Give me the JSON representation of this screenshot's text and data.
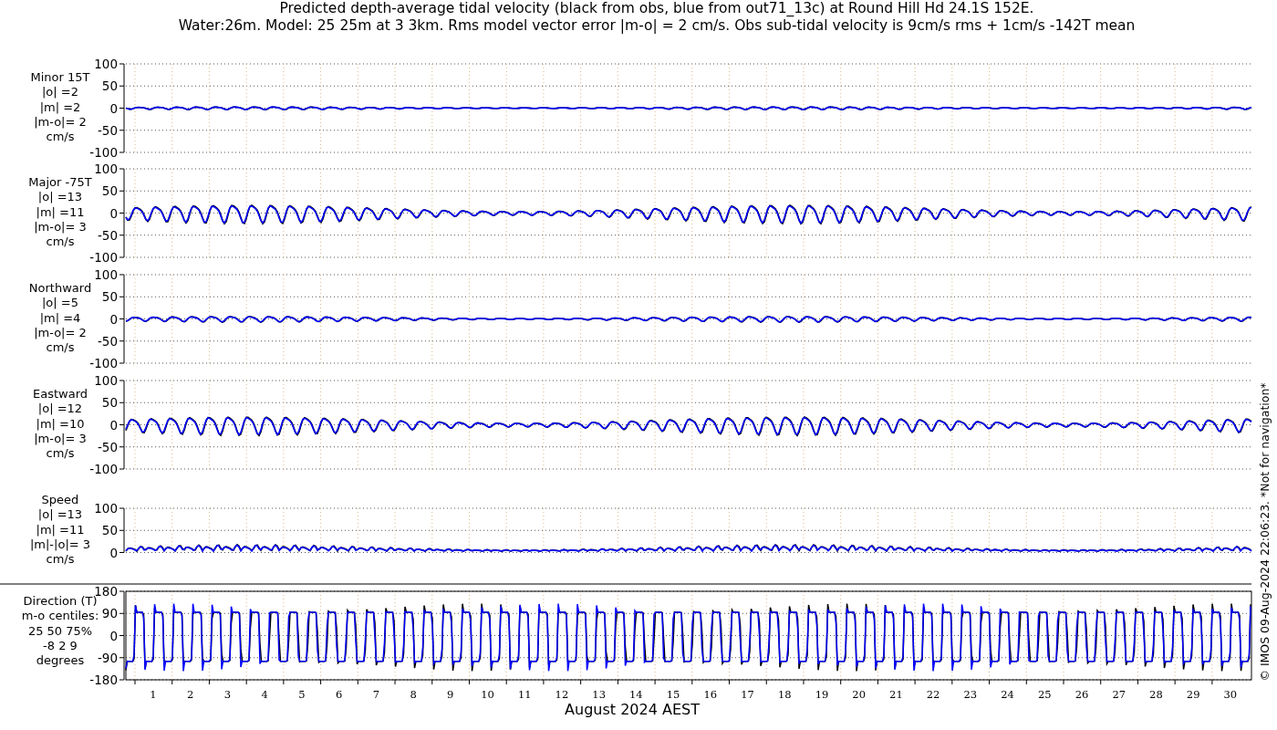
{
  "title_lines": [
    "Predicted depth-average tidal velocity (black from obs, blue from out71_13c) at Round Hill Hd 24.1S 152E.",
    "Water:26m. Model: 25 25m at 3 3km. Rms model vector error |m-o| = 2 cm/s. Obs sub-tidal velocity is 9cm/s rms + 1cm/s -142T mean"
  ],
  "panels": [
    {
      "kind": "velocity",
      "label_lines": [
        "Minor 15T",
        "|o| =2",
        "|m| =2",
        "|m-o|= 2",
        "cm/s"
      ],
      "yticks": [
        "100",
        "50",
        "0",
        "-50",
        "-100"
      ]
    },
    {
      "kind": "velocity",
      "label_lines": [
        "Major -75T",
        "|o| =13",
        "|m| =11",
        "|m-o|= 3",
        "cm/s"
      ],
      "yticks": [
        "100",
        "50",
        "0",
        "-50",
        "-100"
      ]
    },
    {
      "kind": "velocity",
      "label_lines": [
        "Northward",
        "|o| =5",
        "|m| =4",
        "|m-o|= 2",
        "cm/s"
      ],
      "yticks": [
        "100",
        "50",
        "0",
        "-50",
        "-100"
      ]
    },
    {
      "kind": "velocity",
      "label_lines": [
        "Eastward",
        "|o| =12",
        "|m| =10",
        "|m-o|= 3",
        "cm/s"
      ],
      "yticks": [
        "100",
        "50",
        "0",
        "-50",
        "-100"
      ]
    },
    {
      "kind": "speed",
      "label_lines": [
        "Speed",
        "|o| =13",
        "|m| =11",
        "|m|-|o|= 3",
        "cm/s"
      ],
      "yticks": [
        "100",
        "50",
        "0"
      ]
    }
  ],
  "direction_panel": {
    "label_lines": [
      "Direction (T)",
      "m-o centiles:",
      "25  50  75%",
      "-8  2  9",
      "degrees"
    ],
    "yticks": [
      "180",
      "90",
      "0",
      "-90",
      "-180"
    ]
  },
  "x_ticks": [
    "1",
    "2",
    "3",
    "4",
    "5",
    "6",
    "7",
    "8",
    "9",
    "10",
    "11",
    "12",
    "13",
    "14",
    "15",
    "16",
    "17",
    "18",
    "19",
    "20",
    "21",
    "22",
    "23",
    "24",
    "25",
    "26",
    "27",
    "28",
    "29",
    "30"
  ],
  "xlabel": "August 2024 AEST",
  "side_note": "© IMOS 09-Aug-2024 22:06:23. *Not for navigation*"
}
